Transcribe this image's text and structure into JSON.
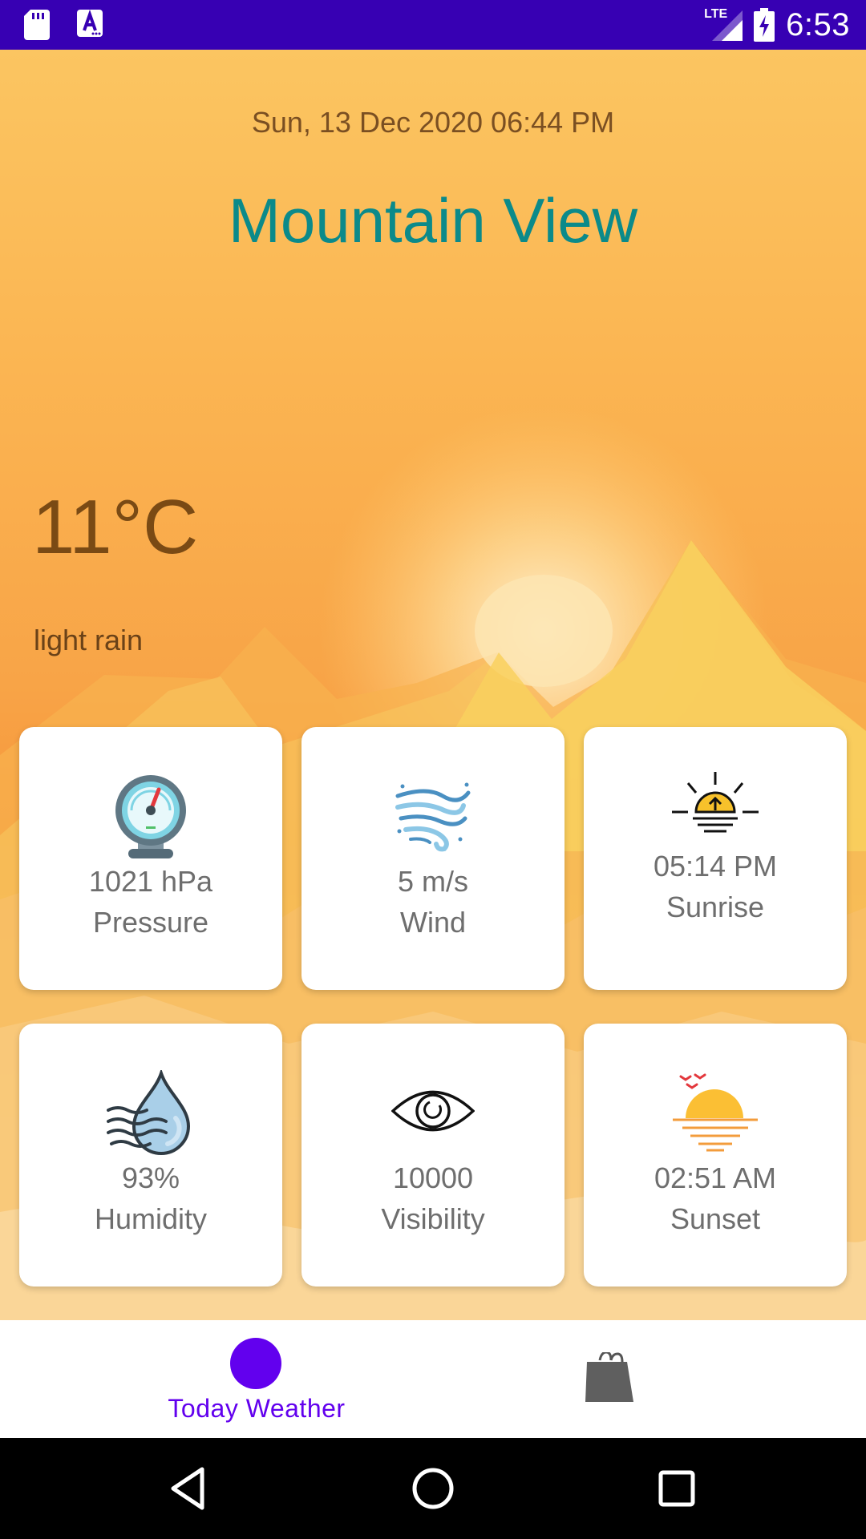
{
  "status_bar": {
    "time": "6:53",
    "network_label": "LTE",
    "left_icons": [
      "sd-card-icon",
      "font-notification-icon"
    ],
    "right_icons": [
      "lte-signal-icon",
      "battery-charging-icon"
    ]
  },
  "weather": {
    "date_time": "Sun, 13 Dec 2020 06:44 PM",
    "city": "Mountain View",
    "temperature": "11°C",
    "description": "light rain"
  },
  "cards": [
    {
      "icon": "barometer-icon",
      "value": "1021 hPa",
      "label": "Pressure"
    },
    {
      "icon": "wind-icon",
      "value": "5 m/s",
      "label": "Wind"
    },
    {
      "icon": "sunrise-icon",
      "value": "05:14 PM",
      "label": "Sunrise"
    },
    {
      "icon": "humidity-icon",
      "value": "93%",
      "label": "Humidity"
    },
    {
      "icon": "eye-icon",
      "value": "10000",
      "label": "Visibility"
    },
    {
      "icon": "sunset-icon",
      "value": "02:51 AM",
      "label": "Sunset"
    }
  ],
  "bottom_nav": {
    "items": [
      {
        "label": "Today Weather",
        "icon": "circle-dot-icon",
        "selected": true
      },
      {
        "label": "",
        "icon": "shopping-bag-icon",
        "selected": false
      }
    ]
  },
  "system_nav": {
    "buttons": [
      "back-icon",
      "home-icon",
      "recents-icon"
    ]
  },
  "colors": {
    "status_bar": "#3700b3",
    "accent": "#6200ee",
    "city_text": "#0b8a8a"
  }
}
